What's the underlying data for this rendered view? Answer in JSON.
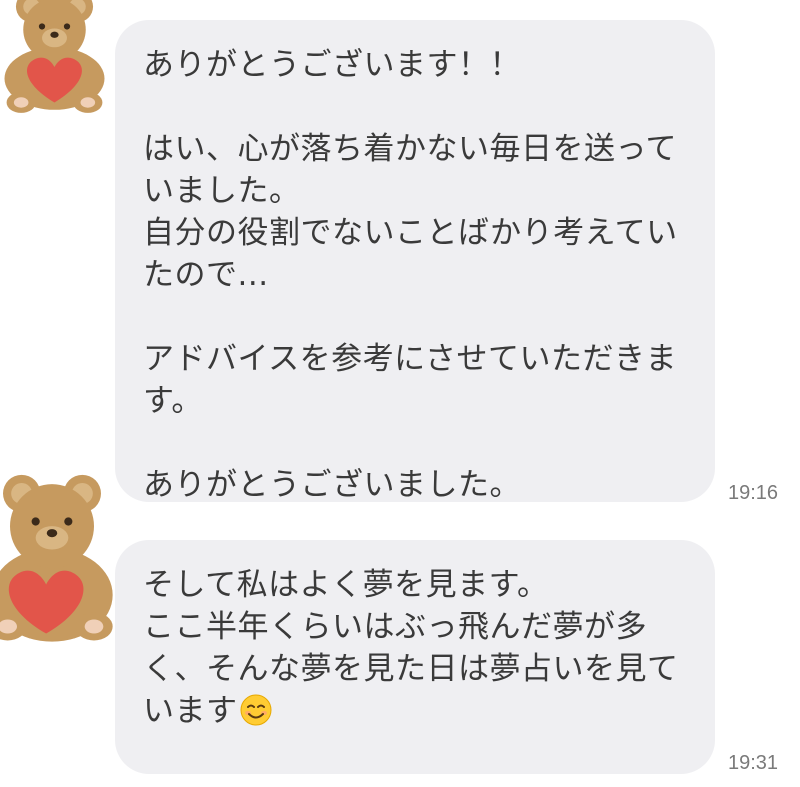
{
  "messages": [
    {
      "lines": [
        "ありがとうございます！！",
        "",
        "はい、心が落ち着かない毎日を送って",
        "いました。",
        "自分の役割でないことばかり考えてい",
        "たので...",
        "",
        "アドバイスを参考にさせていただきま",
        "す。",
        "",
        "ありがとうございました。"
      ],
      "time": "19:16"
    },
    {
      "lines": [
        "そして私はよく夢を見ます。",
        "ここ半年くらいはぶっ飛んだ夢が多",
        "く、そんな夢を見た日は夢占いを見て",
        "います"
      ],
      "time": "19:31"
    }
  ],
  "colors": {
    "bubble": "#efeff2",
    "bear": "#c69a5f",
    "heart": "#e2554a"
  },
  "icons": {
    "avatar": "teddy-bear-with-heart-icon",
    "emoji": "smiling-face-emoji-icon"
  }
}
